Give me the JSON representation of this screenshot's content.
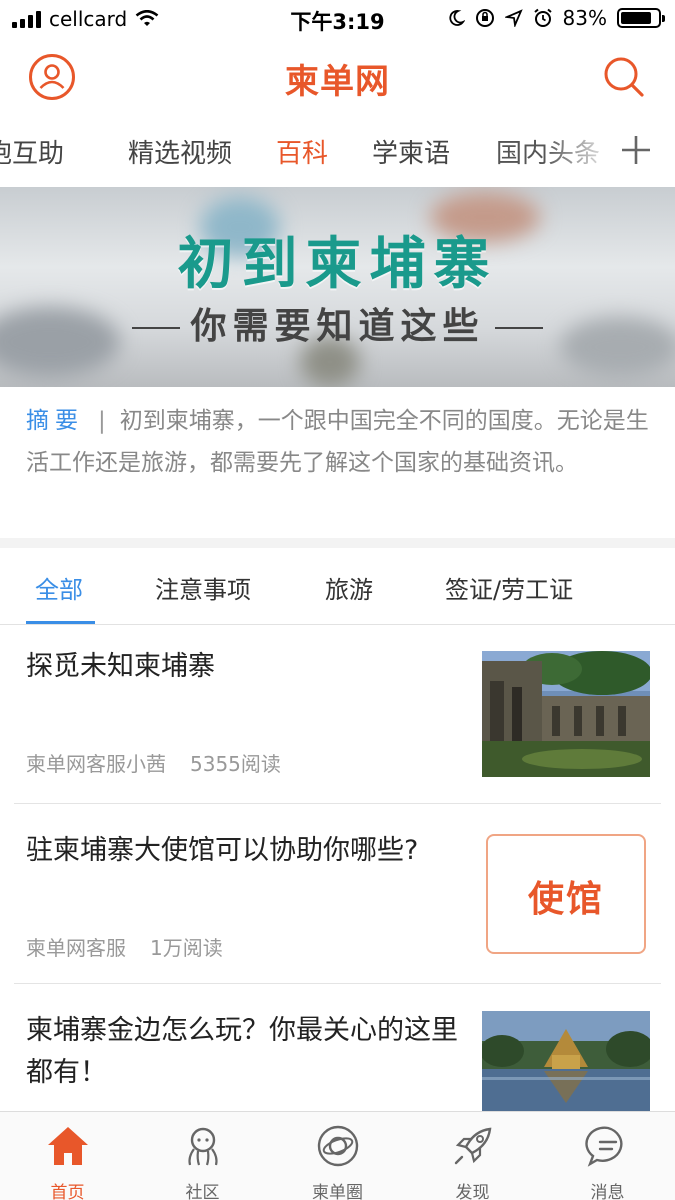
{
  "status_bar": {
    "carrier": "cellcard",
    "time": "下午3:19",
    "battery": "83%",
    "battery_level": 0.83
  },
  "header": {
    "logo": "柬单网",
    "avatar_icon": "user-icon",
    "search_icon": "search-icon"
  },
  "channels": {
    "items": [
      "胞互助",
      "精选视频",
      "百科",
      "学柬语",
      "国内头条"
    ],
    "active": "百科",
    "add_icon": "plus-icon"
  },
  "banner": {
    "title": "初到柬埔寨",
    "subtitle": "你需要知道这些"
  },
  "summary": {
    "tag": "摘要",
    "separator": "|",
    "text": "初到柬埔寨，一个跟中国完全不同的国度。无论是生活工作还是旅游，都需要先了解这个国家的基础资讯。"
  },
  "subtabs": {
    "items": [
      "全部",
      "注意事项",
      "旅游",
      "签证/劳工证"
    ],
    "active": "全部"
  },
  "articles": [
    {
      "title": "探觅未知柬埔寨",
      "author": "柬单网客服小茜",
      "reads": "5355阅读"
    },
    {
      "title": "驻柬埔寨大使馆可以协助你哪些?",
      "author": "柬单网客服",
      "reads": "1万阅读",
      "thumb_text": "使馆"
    },
    {
      "title": "柬埔寨金边怎么玩？你最关心的这里都有！"
    }
  ],
  "tabbar": {
    "items": [
      {
        "label": "首页",
        "icon": "home-icon",
        "active": true
      },
      {
        "label": "社区",
        "icon": "community-icon"
      },
      {
        "label": "柬单圈",
        "icon": "planet-icon"
      },
      {
        "label": "发现",
        "icon": "rocket-icon"
      },
      {
        "label": "消息",
        "icon": "message-icon"
      }
    ]
  },
  "colors": {
    "brand": "#e8572a",
    "accent": "#3a8ee6",
    "banner_title": "#1a9a8c"
  }
}
